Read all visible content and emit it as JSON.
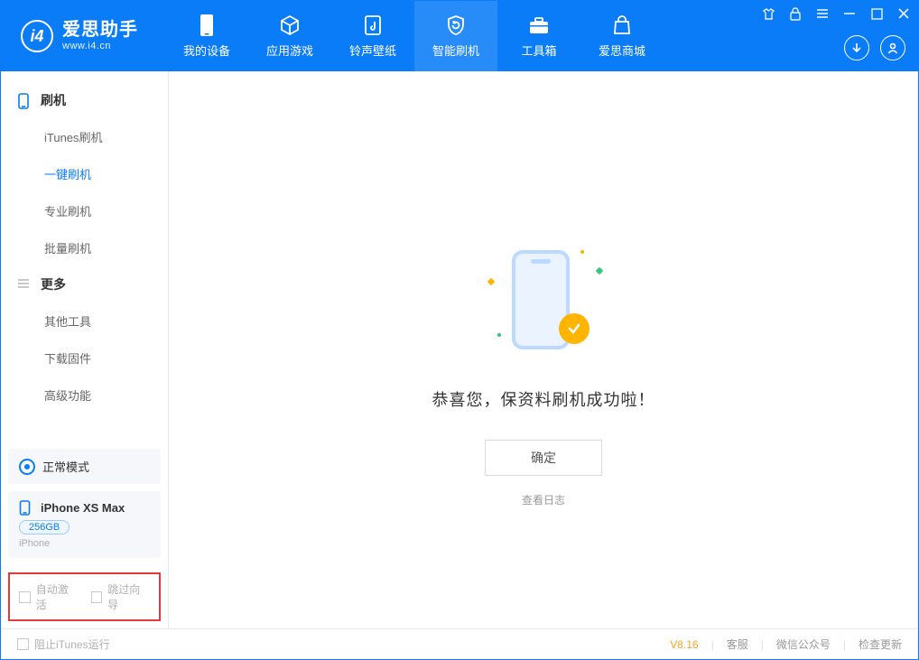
{
  "app": {
    "name": "爱思助手",
    "url": "www.i4.cn"
  },
  "nav": {
    "items": [
      {
        "label": "我的设备"
      },
      {
        "label": "应用游戏"
      },
      {
        "label": "铃声壁纸"
      },
      {
        "label": "智能刷机"
      },
      {
        "label": "工具箱"
      },
      {
        "label": "爱思商城"
      }
    ]
  },
  "sidebar": {
    "group_flash": "刷机",
    "items_flash": [
      {
        "label": "iTunes刷机"
      },
      {
        "label": "一键刷机"
      },
      {
        "label": "专业刷机"
      },
      {
        "label": "批量刷机"
      }
    ],
    "group_more": "更多",
    "items_more": [
      {
        "label": "其他工具"
      },
      {
        "label": "下载固件"
      },
      {
        "label": "高级功能"
      }
    ],
    "mode": "正常模式",
    "device": {
      "name": "iPhone XS Max",
      "capacity": "256GB",
      "type": "iPhone"
    },
    "opts": {
      "auto_activate": "自动激活",
      "skip_guide": "跳过向导"
    }
  },
  "main": {
    "message": "恭喜您，保资料刷机成功啦！",
    "ok": "确定",
    "view_log": "查看日志"
  },
  "status": {
    "block_itunes": "阻止iTunes运行",
    "version": "V8.16",
    "service": "客服",
    "wechat": "微信公众号",
    "check_update": "检查更新"
  }
}
